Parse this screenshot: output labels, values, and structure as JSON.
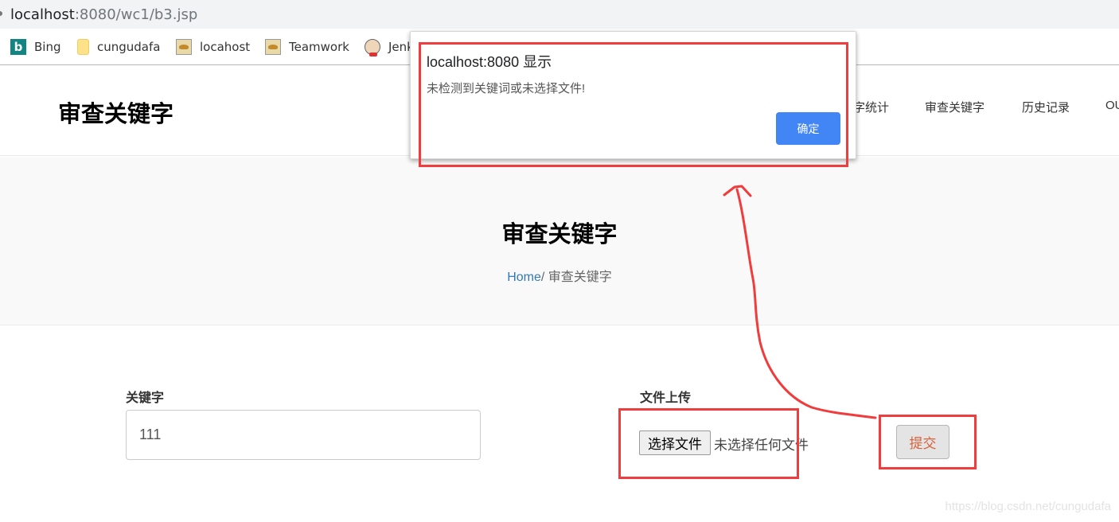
{
  "browser": {
    "url_host": "localhost",
    "url_rest": ":8080/wc1/b3.jsp",
    "bookmarks": [
      {
        "label": "Bing",
        "icon": "bing-icon"
      },
      {
        "label": "cungudafa",
        "icon": "folder-icon"
      },
      {
        "label": "locahost",
        "icon": "tomcat-icon"
      },
      {
        "label": "Teamwork",
        "icon": "tomcat-icon"
      },
      {
        "label": "Jenk",
        "icon": "jenkins-icon"
      }
    ]
  },
  "header": {
    "logo": "审查关键字",
    "nav": [
      {
        "label": "字统计"
      },
      {
        "label": "审查关键字"
      },
      {
        "label": "历史记录"
      },
      {
        "label": "OU"
      }
    ]
  },
  "banner": {
    "title": "审查关键字",
    "breadcrumb_home": "Home",
    "breadcrumb_sep": "/",
    "breadcrumb_current": " 审查关键字"
  },
  "form": {
    "keyword_label": "关键字",
    "keyword_value": "111",
    "file_label": "文件上传",
    "file_button": "选择文件",
    "file_status": "未选择任何文件",
    "submit": "提交"
  },
  "dialog": {
    "title": "localhost:8080 显示",
    "message": "未检测到关键词或未选择文件!",
    "ok": "确定"
  },
  "colors": {
    "annotation": "#f03c3c",
    "dialog_button": "#4285f4",
    "link": "#337ab7",
    "submit_text": "#d9613a"
  },
  "watermark": "https://blog.csdn.net/cungudafa"
}
